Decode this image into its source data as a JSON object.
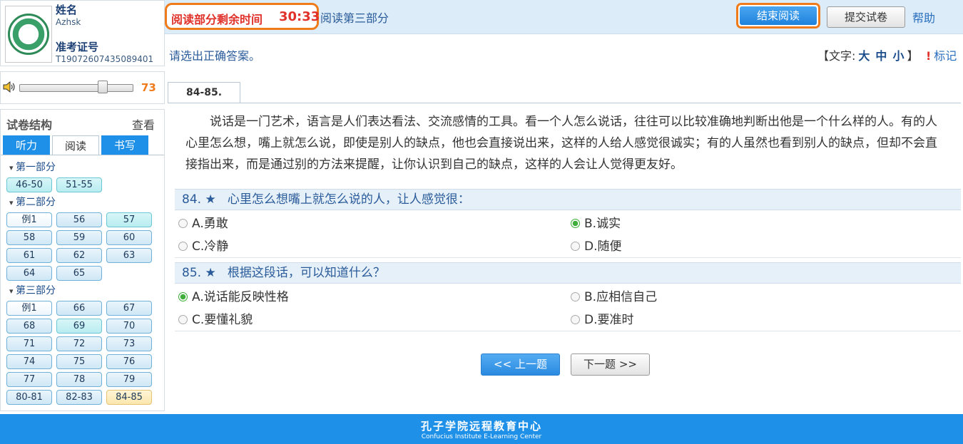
{
  "profile": {
    "name_label": "姓名",
    "name_value": "Azhsk",
    "id_label": "准考证号",
    "id_value": "T19072607435089401"
  },
  "volume": {
    "value": "73",
    "level": 0.73
  },
  "structure": {
    "title": "试卷结构",
    "view": "查看",
    "tabs": [
      "听力",
      "阅读",
      "书写"
    ],
    "active_tab": "阅读",
    "sections": [
      {
        "title": "第一部分",
        "items": [
          {
            "label": "46-50",
            "state": "answered"
          },
          {
            "label": "51-55",
            "state": "answered"
          }
        ]
      },
      {
        "title": "第二部分",
        "items": [
          {
            "label": "例1",
            "state": "sample"
          },
          {
            "label": "56",
            "state": "default"
          },
          {
            "label": "57",
            "state": "answered"
          },
          {
            "label": "58",
            "state": "default"
          },
          {
            "label": "59",
            "state": "default"
          },
          {
            "label": "60",
            "state": "default"
          },
          {
            "label": "61",
            "state": "default"
          },
          {
            "label": "62",
            "state": "default"
          },
          {
            "label": "63",
            "state": "default"
          },
          {
            "label": "64",
            "state": "default"
          },
          {
            "label": "65",
            "state": "default"
          }
        ]
      },
      {
        "title": "第三部分",
        "items": [
          {
            "label": "例1",
            "state": "sample"
          },
          {
            "label": "66",
            "state": "default"
          },
          {
            "label": "67",
            "state": "default"
          },
          {
            "label": "68",
            "state": "default"
          },
          {
            "label": "69",
            "state": "answered"
          },
          {
            "label": "70",
            "state": "default"
          },
          {
            "label": "71",
            "state": "default"
          },
          {
            "label": "72",
            "state": "default"
          },
          {
            "label": "73",
            "state": "default"
          },
          {
            "label": "74",
            "state": "default"
          },
          {
            "label": "75",
            "state": "default"
          },
          {
            "label": "76",
            "state": "default"
          },
          {
            "label": "77",
            "state": "default"
          },
          {
            "label": "78",
            "state": "default"
          },
          {
            "label": "79",
            "state": "default"
          },
          {
            "label": "80-81",
            "state": "default"
          },
          {
            "label": "82-83",
            "state": "default"
          },
          {
            "label": "84-85",
            "state": "current"
          }
        ]
      }
    ]
  },
  "topbar": {
    "timer_label": "阅读部分剩余时间",
    "timer_value": "30:33",
    "section_title": "阅读第三部分",
    "end_button": "结束阅读",
    "submit_button": "提交试卷",
    "help": "帮助"
  },
  "instruction": "请选出正确答案。",
  "textsize": {
    "prefix": "【文字:",
    "large": "大",
    "medium": "中",
    "small": "小",
    "suffix": "】"
  },
  "mark": "标记",
  "passage_tab": "84-85.",
  "passage": "说话是一门艺术，语言是人们表达看法、交流感情的工具。看一个人怎么说话，往往可以比较准确地判断出他是一个什么样的人。有的人心里怎么想，嘴上就怎么说，即使是别人的缺点，他也会直接说出来，这样的人给人感觉很诚实；有的人虽然也看到别人的缺点，但却不会直接指出来，而是通过别的方法来提醒，让你认识到自己的缺点，这样的人会让人觉得更友好。",
  "questions": [
    {
      "number": "84.",
      "star": "★",
      "text": "心里怎么想嘴上就怎么说的人，让人感觉很：",
      "options": [
        "A.勇敢",
        "B.诚实",
        "C.冷静",
        "D.随便"
      ],
      "selected": 1
    },
    {
      "number": "85.",
      "star": "★",
      "text": "根据这段话，可以知道什么？",
      "options": [
        "A.说话能反映性格",
        "B.应相信自己",
        "C.要懂礼貌",
        "D.要准时"
      ],
      "selected": 0
    }
  ],
  "nav": {
    "prev": "<< 上一题",
    "next": "下一题 >>"
  },
  "footer": {
    "cn": "孔子学院远程教育中心",
    "en": "Confucius Institute E-Learning Center"
  }
}
